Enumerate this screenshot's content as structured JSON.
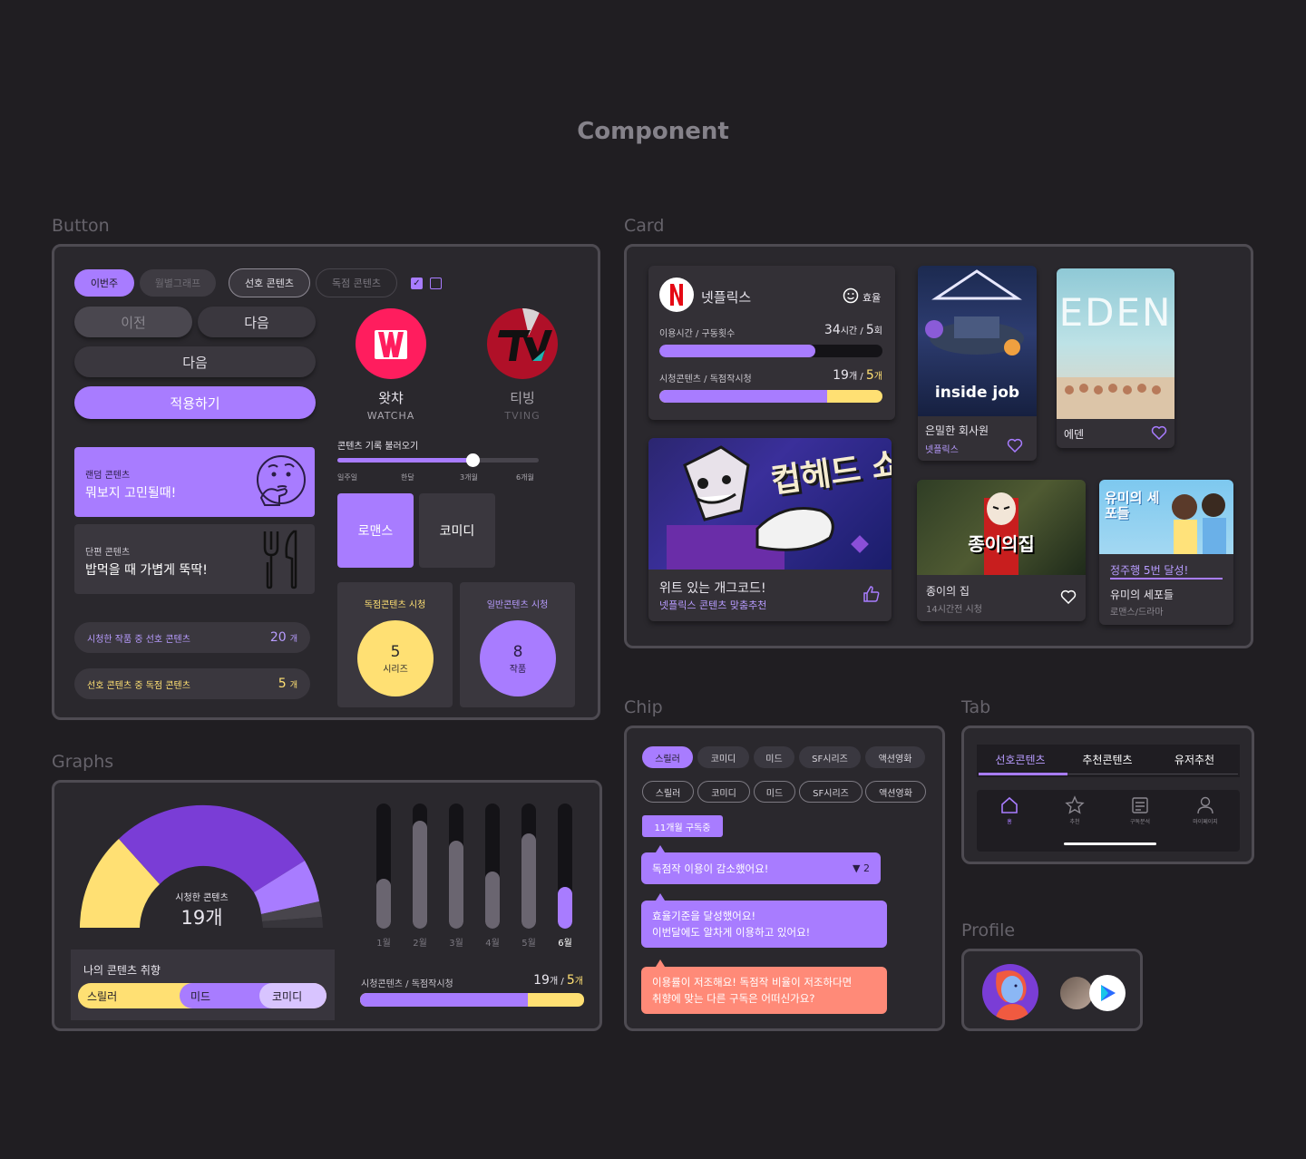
{
  "page_title": "Component",
  "sections": {
    "button": "Button",
    "card": "Card",
    "graphs": "Graphs",
    "chip": "Chip",
    "tab": "Tab",
    "profile": "Profile"
  },
  "colors": {
    "bg": "#201e22",
    "panel": "#2a282d",
    "accent": "#a87cff",
    "yellow": "#ffe073",
    "coral": "#ff8a78"
  },
  "button": {
    "top_pills": [
      "이번주",
      "월별그래프",
      "선호 콘텐츠",
      "독점 콘텐츠"
    ],
    "prev": "이전",
    "next": "다음",
    "next_full": "다음",
    "apply": "적용하기",
    "services": [
      {
        "name": "왓챠",
        "en": "WATCHA",
        "icon": "watcha-logo-icon"
      },
      {
        "name": "티빙",
        "en": "TVING",
        "icon": "tving-logo-icon"
      }
    ],
    "slider": {
      "title": "콘텐츠 기록 불러오기",
      "ticks": [
        "일주일",
        "한달",
        "3개월",
        "6개월"
      ],
      "value": 0.67
    },
    "random": {
      "tag": "랜덤 콘텐츠",
      "title": "뭐보지 고민될때!"
    },
    "short": {
      "tag": "단편 콘텐츠",
      "title": "밥먹을 때 가볍게 뚝딱!"
    },
    "genres": [
      "로맨스",
      "코미디"
    ],
    "stat_rows": [
      {
        "label": "시청한 작품 중 선호 콘텐츠",
        "value": "20",
        "unit": "개"
      },
      {
        "label": "선호 콘텐츠 중 독점 콘텐츠",
        "value": "5",
        "unit": "개"
      }
    ],
    "watch_boxes": [
      {
        "title": "독점콘텐츠 시청",
        "value": "5",
        "unit": "시리즈"
      },
      {
        "title": "일반콘텐츠 시청",
        "value": "8",
        "unit": "작품"
      }
    ]
  },
  "card": {
    "netflix": {
      "name": "넷플릭스",
      "badge": "효율",
      "row1_label": "이용시간 / 구동횟수",
      "row1_a": "34",
      "row1_a_unit": "시간 / ",
      "row1_b": "5",
      "row1_b_unit": "회",
      "row1_fill": 0.7,
      "row2_label": "시청콘텐츠 / 독점작시청",
      "row2_a": "19",
      "row2_a_unit": "개 / ",
      "row2_b": "5",
      "row2_b_unit": "개",
      "row2_fill": 0.75
    },
    "banner": {
      "poster_text": "컵헤드 쇼!",
      "title": "위트 있는 개그코드!",
      "subtitle": "넷플릭스 콘텐츠 맞춤추천"
    },
    "posters": [
      {
        "title": "은밀한 회사원",
        "sub": "넷플릭스",
        "art": "inside job"
      },
      {
        "title": "에덴",
        "sub": "",
        "art": "EDEN"
      },
      {
        "title": "종이의 집",
        "sub": "14시간전 시청",
        "art": "종이의집"
      },
      {
        "title": "유미의 세포들",
        "sub": "로맨스/드라마",
        "badge": "정주행 5번 달성!",
        "art": "유미의 세포들"
      }
    ]
  },
  "graphs": {
    "gauge": {
      "label": "시청한 콘텐츠",
      "value": "19개"
    },
    "taste": {
      "title": "나의 콘텐츠 취향",
      "segments": [
        "스릴러",
        "미드",
        "코미디"
      ]
    },
    "chart_data": {
      "type": "bar",
      "categories": [
        "1월",
        "2월",
        "3월",
        "4월",
        "5월",
        "6월"
      ],
      "values": [
        0.4,
        0.86,
        0.7,
        0.46,
        0.76,
        0.33
      ],
      "ylim": [
        0,
        1
      ]
    },
    "progress": {
      "label": "시청콘텐츠 / 독점작시청",
      "a": "19",
      "a_unit": "개 / ",
      "b": "5",
      "b_unit": "개",
      "fill": 0.75
    }
  },
  "chip": {
    "row1": [
      "스릴러",
      "코미디",
      "미드",
      "SF시리즈",
      "액션영화"
    ],
    "row2": [
      "스릴러",
      "코미디",
      "미드",
      "SF시리즈",
      "액션영화"
    ],
    "sub_tag": "11개월 구독중",
    "msg1": "독점작 이용이 감소했어요!",
    "msg1_badge": "▼ 2",
    "msg2_l1": "효율기준을 달성했어요!",
    "msg2_l2": "이번달에도 알차게 이용하고 있어요!",
    "msg3_l1": "이용률이 저조해요! 독점작 비율이 저조하다면",
    "msg3_l2": "취향에 맞는 다른 구독은 어떠신가요?"
  },
  "tab": {
    "tabs": [
      "선호콘텐츠",
      "추천콘텐츠",
      "유저추천"
    ],
    "nav": [
      {
        "icon": "home-icon",
        "label": "홈"
      },
      {
        "icon": "star-icon",
        "label": "추천"
      },
      {
        "icon": "report-icon",
        "label": "구독분석"
      },
      {
        "icon": "user-icon",
        "label": "마이페이지"
      }
    ]
  }
}
